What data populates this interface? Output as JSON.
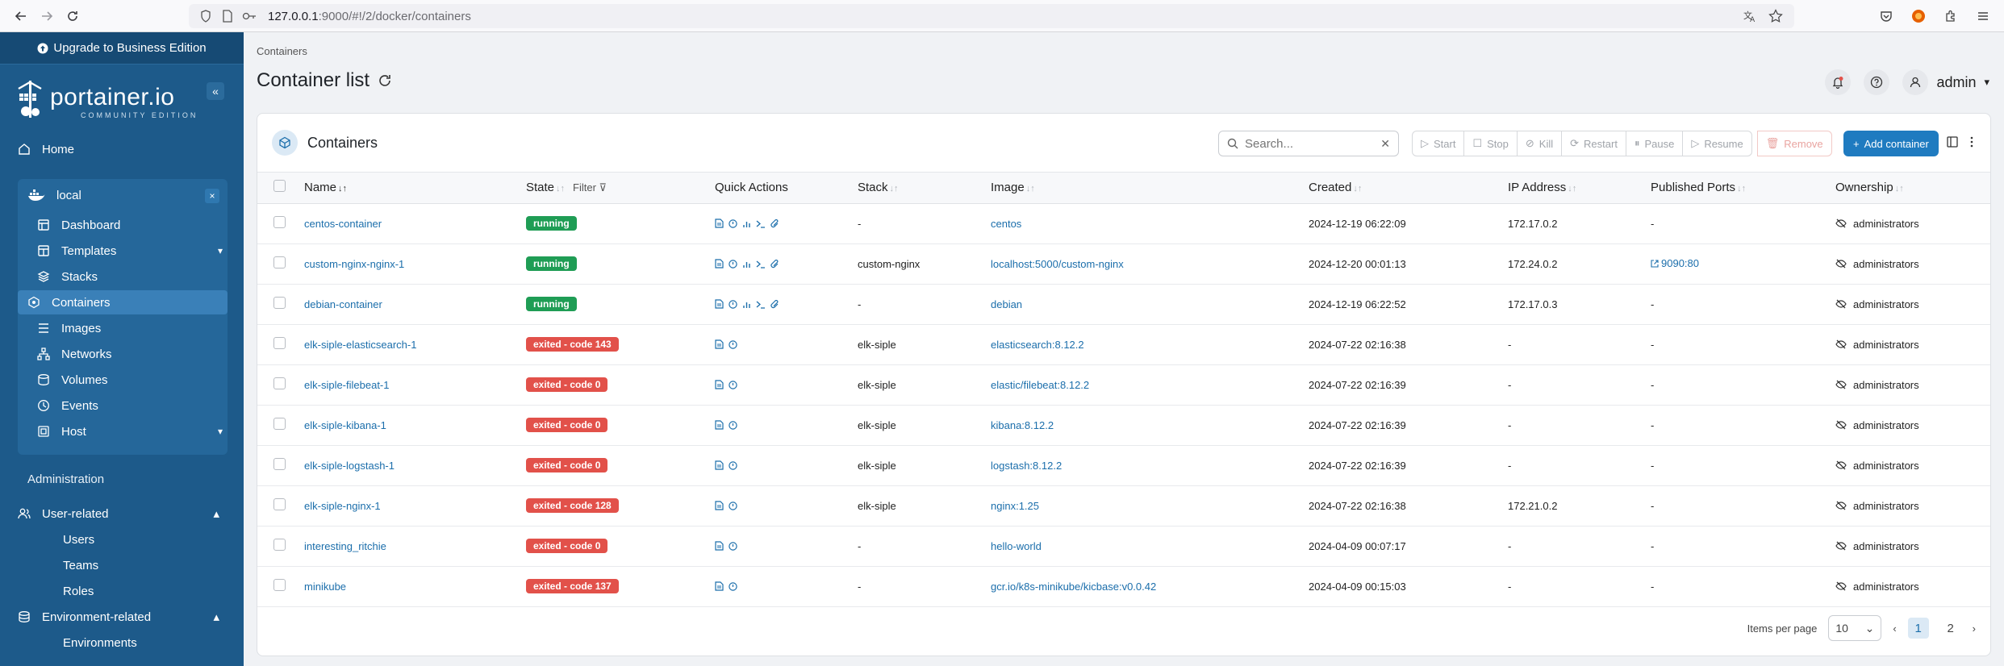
{
  "browser": {
    "url_host": "127.0.0.1",
    "url_rest": ":9000/#!/2/docker/containers"
  },
  "sidebar": {
    "upgrade_label": "Upgrade to Business Edition",
    "logo_text": "portainer.io",
    "logo_sub": "COMMUNITY EDITION",
    "home_label": "Home",
    "env_name": "local",
    "env_items": {
      "dashboard": "Dashboard",
      "templates": "Templates",
      "stacks": "Stacks",
      "containers": "Containers",
      "images": "Images",
      "networks": "Networks",
      "volumes": "Volumes",
      "events": "Events",
      "host": "Host"
    },
    "admin_title": "Administration",
    "user_related": "User-related",
    "users": "Users",
    "teams": "Teams",
    "roles": "Roles",
    "env_related": "Environment-related",
    "environments": "Environments"
  },
  "main": {
    "breadcrumb": "Containers",
    "title": "Container list",
    "user": "admin",
    "card_title": "Containers",
    "search_placeholder": "Search...",
    "actions": {
      "start": "Start",
      "stop": "Stop",
      "kill": "Kill",
      "restart": "Restart",
      "pause": "Pause",
      "resume": "Resume",
      "remove": "Remove",
      "add": "Add container"
    },
    "columns": {
      "name": "Name",
      "state": "State",
      "filter": "Filter",
      "quick_actions": "Quick Actions",
      "stack": "Stack",
      "image": "Image",
      "created": "Created",
      "ip": "IP Address",
      "ports": "Published Ports",
      "ownership": "Ownership"
    },
    "pagination": {
      "items_per_page_label": "Items per page",
      "items_per_page": "10",
      "page1": "1",
      "page2": "2"
    }
  },
  "rows": [
    {
      "name": "centos-container",
      "state": "running",
      "stack": "-",
      "image": "centos",
      "created": "2024-12-19 06:22:09",
      "ip": "172.17.0.2",
      "ports": "-",
      "ownership": "administrators",
      "full_actions": true
    },
    {
      "name": "custom-nginx-nginx-1",
      "state": "running",
      "stack": "custom-nginx",
      "image": "localhost:5000/custom-nginx",
      "created": "2024-12-20 00:01:13",
      "ip": "172.24.0.2",
      "ports": "9090:80",
      "ownership": "administrators",
      "full_actions": true
    },
    {
      "name": "debian-container",
      "state": "running",
      "stack": "-",
      "image": "debian",
      "created": "2024-12-19 06:22:52",
      "ip": "172.17.0.3",
      "ports": "-",
      "ownership": "administrators",
      "full_actions": true
    },
    {
      "name": "elk-siple-elasticsearch-1",
      "state": "exited - code 143",
      "stack": "elk-siple",
      "image": "elasticsearch:8.12.2",
      "created": "2024-07-22 02:16:38",
      "ip": "-",
      "ports": "-",
      "ownership": "administrators",
      "full_actions": false
    },
    {
      "name": "elk-siple-filebeat-1",
      "state": "exited - code 0",
      "stack": "elk-siple",
      "image": "elastic/filebeat:8.12.2",
      "created": "2024-07-22 02:16:39",
      "ip": "-",
      "ports": "-",
      "ownership": "administrators",
      "full_actions": false
    },
    {
      "name": "elk-siple-kibana-1",
      "state": "exited - code 0",
      "stack": "elk-siple",
      "image": "kibana:8.12.2",
      "created": "2024-07-22 02:16:39",
      "ip": "-",
      "ports": "-",
      "ownership": "administrators",
      "full_actions": false
    },
    {
      "name": "elk-siple-logstash-1",
      "state": "exited - code 0",
      "stack": "elk-siple",
      "image": "logstash:8.12.2",
      "created": "2024-07-22 02:16:39",
      "ip": "-",
      "ports": "-",
      "ownership": "administrators",
      "full_actions": false
    },
    {
      "name": "elk-siple-nginx-1",
      "state": "exited - code 128",
      "stack": "elk-siple",
      "image": "nginx:1.25",
      "created": "2024-07-22 02:16:38",
      "ip": "172.21.0.2",
      "ports": "-",
      "ownership": "administrators",
      "full_actions": false
    },
    {
      "name": "interesting_ritchie",
      "state": "exited - code 0",
      "stack": "-",
      "image": "hello-world",
      "created": "2024-04-09 00:07:17",
      "ip": "-",
      "ports": "-",
      "ownership": "administrators",
      "full_actions": false
    },
    {
      "name": "minikube",
      "state": "exited - code 137",
      "stack": "-",
      "image": "gcr.io/k8s-minikube/kicbase:v0.0.42",
      "created": "2024-04-09 00:15:03",
      "ip": "-",
      "ports": "-",
      "ownership": "administrators",
      "full_actions": false
    }
  ]
}
